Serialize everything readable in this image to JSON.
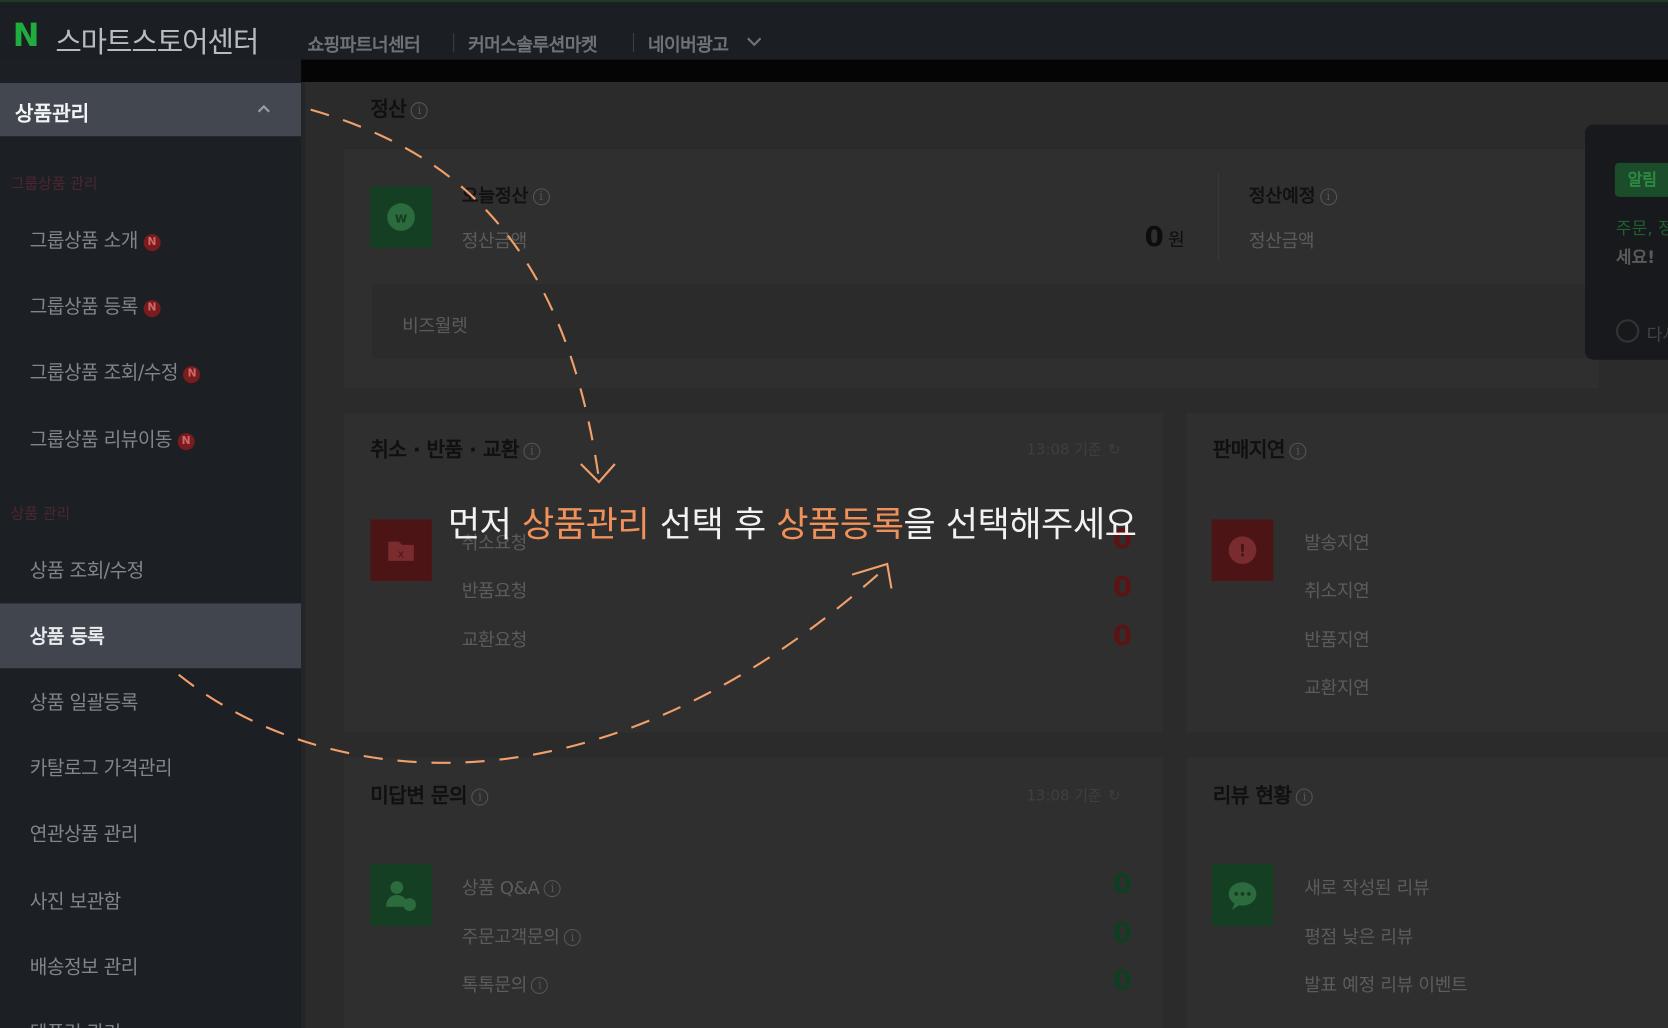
{
  "header": {
    "logo_mark": "N",
    "app_title": "스마트스토어센터",
    "nav": [
      "쇼핑파트너센터",
      "커머스솔루션마켓",
      "네이버광고"
    ]
  },
  "sidebar": {
    "header_label": "상품관리",
    "section_group": "그룹상품 관리",
    "group_items": [
      {
        "label": "그룹상품 소개",
        "badge": "N"
      },
      {
        "label": "그룹상품 등록",
        "badge": "N"
      },
      {
        "label": "그룹상품 조회/수정",
        "badge": "N"
      },
      {
        "label": "그룹상품 리뷰이동",
        "badge": "N"
      }
    ],
    "section_product": "상품 관리",
    "product_items": [
      {
        "label": "상품 조회/수정"
      },
      {
        "label": "상품 등록",
        "active": true
      },
      {
        "label": "상품 일괄등록"
      },
      {
        "label": "카탈로그 가격관리"
      },
      {
        "label": "연관상품 관리"
      },
      {
        "label": "사진 보관함"
      },
      {
        "label": "배송정보 관리"
      },
      {
        "label": "템플릿 관리"
      }
    ]
  },
  "settlement": {
    "title": "정산",
    "today_label": "오늘정산",
    "amount_label": "정산금액",
    "amount_value": "0",
    "amount_unit": "원",
    "planned_label": "정산예정",
    "planned_amount_label": "정산금액",
    "bizwallet": "비즈월렛"
  },
  "cancel_return": {
    "title": "취소 · 반품 · 교환",
    "timestamp": "13:08 기준",
    "rows": [
      {
        "label": "취소요청",
        "value": "0"
      },
      {
        "label": "반품요청",
        "value": "0"
      },
      {
        "label": "교환요청",
        "value": "0"
      }
    ]
  },
  "delay": {
    "title": "판매지연",
    "rows": [
      "발송지연",
      "취소지연",
      "반품지연",
      "교환지연"
    ]
  },
  "inquiry": {
    "title": "미답변 문의",
    "timestamp": "13:08 기준",
    "rows": [
      {
        "label": "상품 Q&A",
        "value": "0"
      },
      {
        "label": "주문고객문의",
        "value": "0"
      },
      {
        "label": "톡톡문의",
        "value": "0"
      }
    ]
  },
  "review": {
    "title": "리뷰 현황",
    "rows": [
      "새로 작성된 리뷰",
      "평점 낮은 리뷰",
      "발표 예정 리뷰 이벤트"
    ]
  },
  "popup": {
    "tag": "알림",
    "line1": "주문, 정",
    "line2": "세요!",
    "option": "다시"
  },
  "overlay": {
    "part1": "먼저 ",
    "highlight1": "상품관리",
    "part2": " 선택 후 ",
    "highlight2": "상품등록",
    "part3": "을 선택해주세요"
  },
  "colors": {
    "accent_orange": "#f0915a",
    "naver_green": "#1fae3e",
    "badge_red": "#7a1b1e"
  }
}
